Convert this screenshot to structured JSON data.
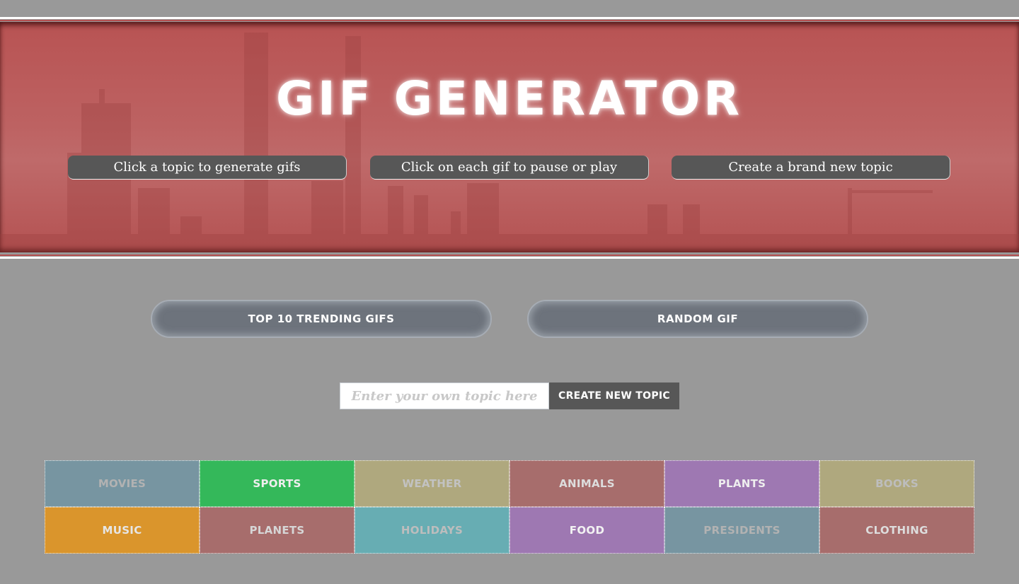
{
  "header": {
    "title": "GIF GENERATOR",
    "instructions": [
      "Click a topic to generate gifs",
      "Click on each gif to pause or play",
      "Create a brand new topic"
    ],
    "banner_color": "#bb5a5a"
  },
  "actions": {
    "trending_label": "TOP 10 TRENDING GIFS",
    "random_label": "RANDOM GIF"
  },
  "topic_form": {
    "input_value": "",
    "input_placeholder": "Enter your own topic here",
    "create_label": "CREATE NEW TOPIC"
  },
  "topics": [
    {
      "label": "MOVIES",
      "bg": "#7795a1",
      "fg": "#b2b2b2"
    },
    {
      "label": "SPORTS",
      "bg": "#34b85a",
      "fg": "#eeeeee"
    },
    {
      "label": "WEATHER",
      "bg": "#afa87e",
      "fg": "#c2c2c2"
    },
    {
      "label": "ANIMALS",
      "bg": "#a76d6c",
      "fg": "#dddddd"
    },
    {
      "label": "PLANTS",
      "bg": "#9e78b2",
      "fg": "#eeeeee"
    },
    {
      "label": "BOOKS",
      "bg": "#afa87e",
      "fg": "#bdbdbd"
    },
    {
      "label": "MUSIC",
      "bg": "#da952c",
      "fg": "#e6e6e6"
    },
    {
      "label": "PLANETS",
      "bg": "#a76d6c",
      "fg": "#d6d6d6"
    },
    {
      "label": "HOLIDAYS",
      "bg": "#67adb3",
      "fg": "#bdbdbd"
    },
    {
      "label": "FOOD",
      "bg": "#9e78b2",
      "fg": "#f2f2f2"
    },
    {
      "label": "PRESIDENTS",
      "bg": "#7795a1",
      "fg": "#b2b2b2"
    },
    {
      "label": "CLOTHING",
      "bg": "#a76d6c",
      "fg": "#dddddd"
    }
  ]
}
